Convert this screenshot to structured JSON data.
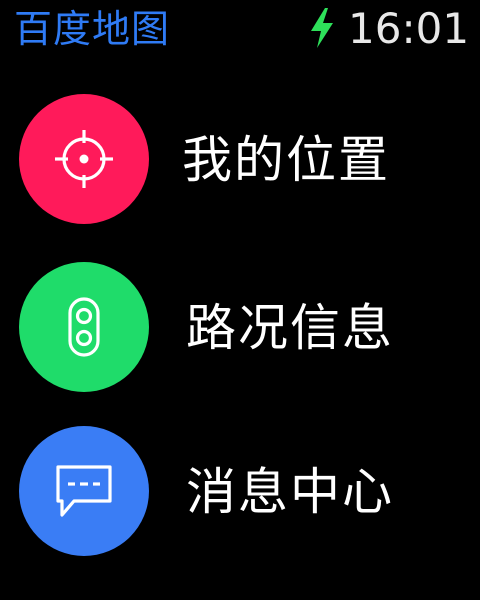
{
  "status_bar": {
    "app_title": "百度地图",
    "time": "16:01",
    "charging_icon": "lightning-bolt-icon",
    "charging_color": "#2ee05a",
    "title_color": "#2f7bf5"
  },
  "menu": {
    "items": [
      {
        "label": "我的位置",
        "icon": "crosshair-icon",
        "color": "#ff1a5a"
      },
      {
        "label": "路况信息",
        "icon": "traffic-light-icon",
        "color": "#1fdc6a"
      },
      {
        "label": "消息中心",
        "icon": "message-bubble-icon",
        "color": "#3a7df5"
      }
    ]
  }
}
